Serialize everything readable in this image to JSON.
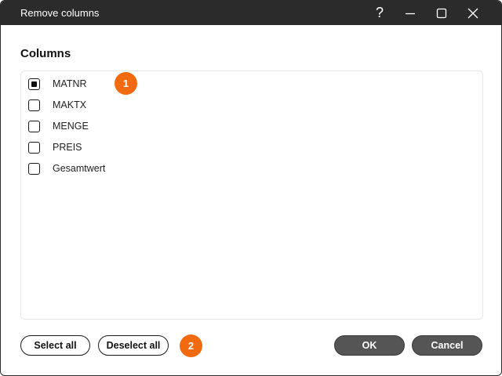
{
  "window": {
    "title": "Remove columns",
    "controls": {
      "help_icon": "?",
      "minimize_icon": "minimize-icon",
      "maximize_icon": "maximize-icon",
      "close_icon": "close-icon"
    }
  },
  "section": {
    "heading": "Columns"
  },
  "columns": [
    {
      "label": "MATNR",
      "checked": true
    },
    {
      "label": "MAKTX",
      "checked": false
    },
    {
      "label": "MENGE",
      "checked": false
    },
    {
      "label": "PREIS",
      "checked": false
    },
    {
      "label": "Gesamtwert",
      "checked": false
    }
  ],
  "badges": [
    "1",
    "2"
  ],
  "footer": {
    "select_all": "Select all",
    "deselect_all": "Deselect all",
    "ok": "OK",
    "cancel": "Cancel"
  },
  "colors": {
    "titlebar": "#2b2b2b",
    "badge": "#f26a0f",
    "primary_button": "#555555"
  }
}
